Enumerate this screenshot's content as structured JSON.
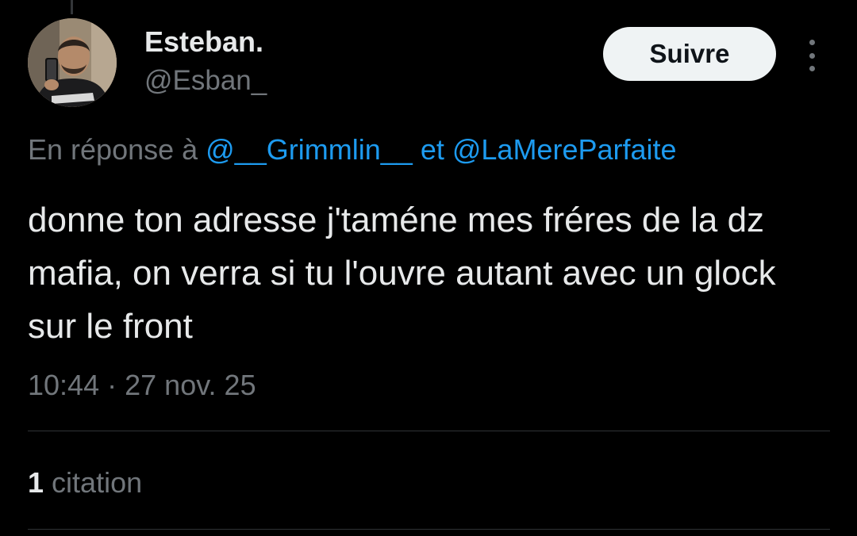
{
  "author": {
    "display_name": "Esteban.",
    "handle": "@Esban_",
    "avatar_icon": "profile-photo"
  },
  "actions": {
    "follow_label": "Suivre",
    "more_icon": "more-vertical-icon"
  },
  "reply_context": {
    "prefix": "En réponse à",
    "mention_1": "@__Grimmlin__",
    "joiner": "et",
    "mention_2": "@LaMereParfaite"
  },
  "tweet": {
    "text": "donne ton adresse j'taméne mes fréres de la dz mafia, on verra si tu l'ouvre autant avec un glock sur le front",
    "time": "10:44",
    "separator": "·",
    "date": "27 nov. 25"
  },
  "stats": {
    "quotes_count": "1",
    "quotes_label": "citation"
  },
  "colors": {
    "background": "#000000",
    "text_primary": "#e7e9ea",
    "text_secondary": "#71767b",
    "link": "#1d9bf0",
    "follow_button_bg": "#eff3f4",
    "divider": "#2f3336"
  }
}
